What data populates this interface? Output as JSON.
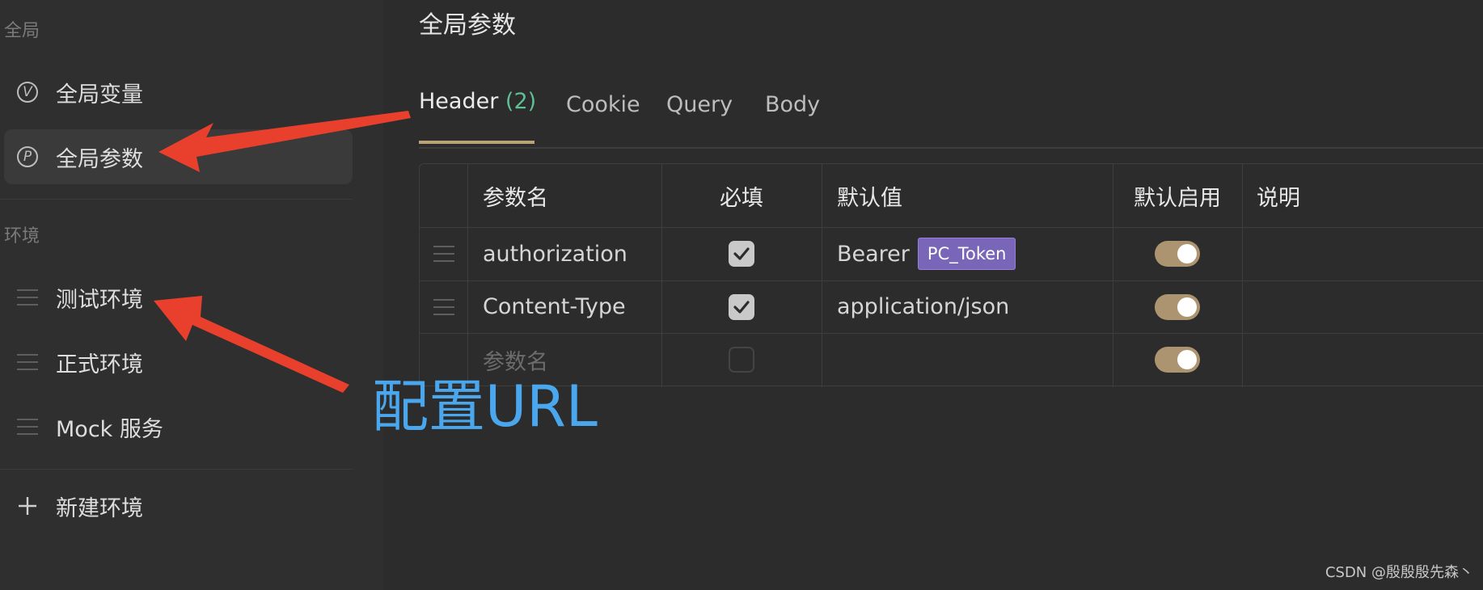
{
  "sidebar": {
    "global_section": "全局",
    "env_section": "环境",
    "items": [
      {
        "label": "全局变量",
        "icon": "circle-v-icon",
        "letter": "V"
      },
      {
        "label": "全局参数",
        "icon": "circle-p-icon",
        "letter": "P",
        "active": true
      }
    ],
    "environments": [
      {
        "label": "测试环境",
        "icon": "menu-lines-icon"
      },
      {
        "label": "正式环境",
        "icon": "menu-lines-icon"
      },
      {
        "label": "Mock 服务",
        "icon": "menu-lines-icon"
      }
    ],
    "new_env_label": "新建环境"
  },
  "main": {
    "title": "全局参数",
    "tabs": [
      {
        "label": "Header",
        "count": "(2)",
        "active": true
      },
      {
        "label": "Cookie"
      },
      {
        "label": "Query"
      },
      {
        "label": "Body"
      }
    ],
    "table": {
      "headers": [
        "参数名",
        "必填",
        "默认值",
        "默认启用",
        "说明"
      ],
      "rows": [
        {
          "name": "authorization",
          "required": true,
          "default_prefix": "Bearer",
          "default_var": "PC_Token",
          "enabled": true,
          "desc": ""
        },
        {
          "name": "Content-Type",
          "required": true,
          "default_prefix": "application/json",
          "default_var": "",
          "enabled": true,
          "desc": ""
        }
      ],
      "new_row_placeholder": "参数名"
    }
  },
  "annotation": {
    "label": "配置URL",
    "arrow_color": "#e8402c",
    "label_color": "#4aa7ee"
  },
  "watermark": "CSDN @殷殷殷先森丶",
  "colors": {
    "accent_tab_underline": "#b9a273",
    "tab_count": "#5fbf95",
    "toggle_on": "#ad9470",
    "variable_chip": "#7a66b8"
  }
}
